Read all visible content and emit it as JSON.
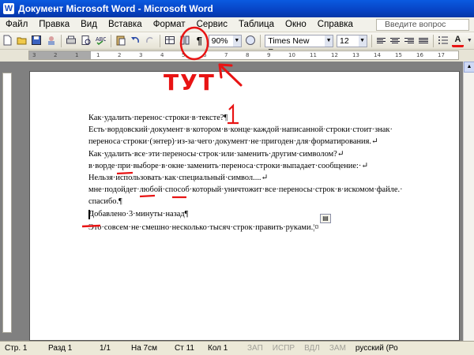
{
  "window": {
    "title": "Документ Microsoft Word - Microsoft Word",
    "app_icon": "W"
  },
  "menu": {
    "items": [
      "Файл",
      "Правка",
      "Вид",
      "Вставка",
      "Формат",
      "Сервис",
      "Таблица",
      "Окно",
      "Справка"
    ],
    "help_placeholder": "Введите вопрос"
  },
  "toolbar": {
    "zoom": "90%",
    "font_name": "Times New Roman",
    "font_size": "12",
    "pilcrow": "¶",
    "font_color_letter": "A"
  },
  "ruler": {
    "ticks": [
      "3",
      "2",
      "1",
      "1",
      "2",
      "3",
      "4",
      "5",
      "6",
      "7",
      "8",
      "9",
      "10",
      "11",
      "12",
      "13",
      "14",
      "15",
      "16",
      "17"
    ]
  },
  "annotation": {
    "text": "ТУТ"
  },
  "document": {
    "lines": [
      "Как·удалить·перенос·строки·в·тексте?¶",
      "Есть·вордовский·документ·в·котором·в·конце·каждой·написанной·строки·стоит·знак·",
      "переноса·строки·(энтер)·из-за·чего·документ·не·пригоден·для·форматирования.↵",
      "Как·удалить·все·эти·переносы·строк·или·заменить·другим·символом?↵",
      "в·ворде·при·выборе·в·окне·заменить·переноса·строки·выпадает·сообщение:·↵",
      "Нельзя·использовать·как·специальный·символ....↵",
      "мне·подойдет·любой·способ·который·уничтожит·все·переносы·строк·в·искомом·файле.·",
      "спасибо.¶",
      "Добавлено·3·минуты·назад¶",
      "Это·совсем·не·смешно·несколько·тысяч·строк·править·руками.¦¤"
    ]
  },
  "statusbar": {
    "page": "Стр. 1",
    "section": "Разд 1",
    "pages": "1/1",
    "at": "На 7см",
    "line": "Ст 11",
    "col": "Кол 1",
    "rec": "ЗАП",
    "trk": "ИСПР",
    "ext": "ВДЛ",
    "ovr": "ЗАМ",
    "lang": "русский (Ро"
  },
  "colors": {
    "annotation": "#e81414",
    "titlebar": "#0743c4"
  }
}
